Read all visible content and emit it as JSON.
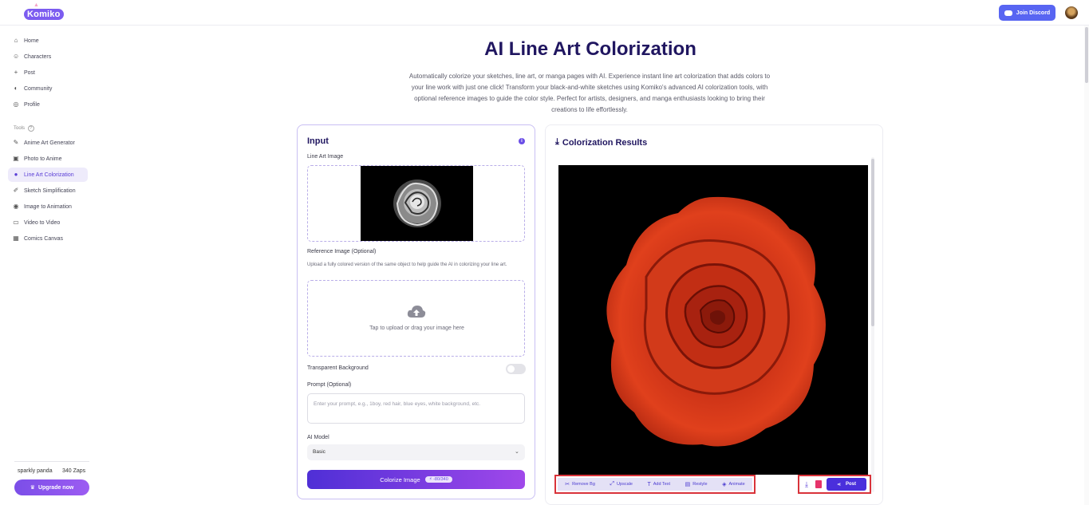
{
  "app": {
    "logo_text": "Komiko"
  },
  "topbar": {
    "discord_label": "Join Discord"
  },
  "sidebar": {
    "items": [
      {
        "label": "Home",
        "icon": "home-icon"
      },
      {
        "label": "Characters",
        "icon": "characters-icon"
      },
      {
        "label": "Post",
        "icon": "plus-icon"
      },
      {
        "label": "Community",
        "icon": "community-icon"
      },
      {
        "label": "Profile",
        "icon": "profile-icon"
      }
    ],
    "tools_label": "Tools",
    "tools": [
      {
        "label": "Anime Art Generator",
        "icon": "wand-icon"
      },
      {
        "label": "Photo to Anime",
        "icon": "photo-icon"
      },
      {
        "label": "Line Art Colorization",
        "icon": "palette-icon",
        "active": true
      },
      {
        "label": "Sketch Simplification",
        "icon": "sketch-icon"
      },
      {
        "label": "Image to Animation",
        "icon": "play-icon"
      },
      {
        "label": "Video to Video",
        "icon": "video-icon"
      },
      {
        "label": "Comics Canvas",
        "icon": "grid-icon"
      }
    ],
    "user": {
      "name": "sparkly panda",
      "zaps": "340 Zaps"
    },
    "upgrade_label": "Upgrade now"
  },
  "header": {
    "title": "AI Line Art Colorization",
    "description": "Automatically colorize your sketches, line art, or manga pages with AI. Experience instant line art colorization that adds colors to your line work with just one click! Transform your black-and-white sketches using Komiko's advanced AI colorization tools, with optional reference images to guide the color style. Perfect for artists, designers, and manga enthusiasts looking to bring their creations to life effortlessly."
  },
  "input": {
    "title": "Input",
    "line_art_label": "Line Art Image",
    "reference_label": "Reference Image (Optional)",
    "reference_help": "Upload a fully colored version of the same object to help guide the AI in colorizing your line art.",
    "upload_text": "Tap to upload or drag your image here",
    "transparent_label": "Transparent Background",
    "transparent_on": false,
    "prompt_label": "Prompt (Optional)",
    "prompt_placeholder": "Enter your prompt, e.g., 1boy, red hair, blue eyes, white background, etc.",
    "model_label": "AI Model",
    "model_value": "Basic",
    "colorize_label": "Colorize Image",
    "cost": "-80/340"
  },
  "results": {
    "title": "Colorization Results",
    "actions": [
      "Remove Bg",
      "Upscale",
      "Add Text",
      "Restyle",
      "Animate"
    ],
    "post_label": "Post"
  },
  "colors": {
    "accent": "#5a3ed6",
    "discord": "#5865f2",
    "highlight": "#d9333a"
  }
}
